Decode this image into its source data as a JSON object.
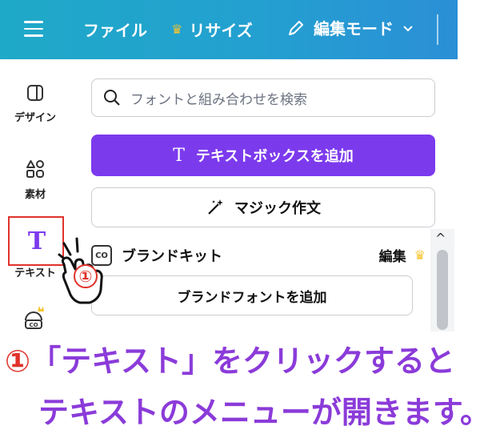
{
  "header": {
    "menu_icon": "hamburger-icon",
    "file_label": "ファイル",
    "resize_label": "リサイズ",
    "resize_icon": "crown-icon",
    "edit_mode_label": "編集モード",
    "edit_mode_icon": "pencil-icon",
    "chevron_icon": "chevron-down-icon",
    "gradient_start": "#1fa9c8",
    "gradient_end": "#2b8fd6"
  },
  "sidebar": {
    "items": [
      {
        "label": "デザイン",
        "icon": "design-icon"
      },
      {
        "label": "素材",
        "icon": "elements-icon"
      },
      {
        "label": "テキスト",
        "icon": "text-icon"
      },
      {
        "label": "",
        "icon": "brand-icon"
      }
    ]
  },
  "panel": {
    "search_placeholder": "フォントと組み合わせを検索",
    "add_textbox_label": "テキストボックスを追加",
    "add_textbox_icon": "T",
    "magic_write_label": "マジック作文",
    "brand_kit_title": "ブランドキット",
    "brand_kit_edit": "編集",
    "add_brand_font_label": "ブランドフォントを追加"
  },
  "annotation": {
    "step_number": "①",
    "line1": "「テキスト」をクリックすると",
    "line2": "テキストのメニューが開きます。",
    "highlight_color": "#e0322b",
    "text_color": "#8b3bd9"
  },
  "colors": {
    "accent": "#7c3aed",
    "highlight": "#e0322b"
  }
}
